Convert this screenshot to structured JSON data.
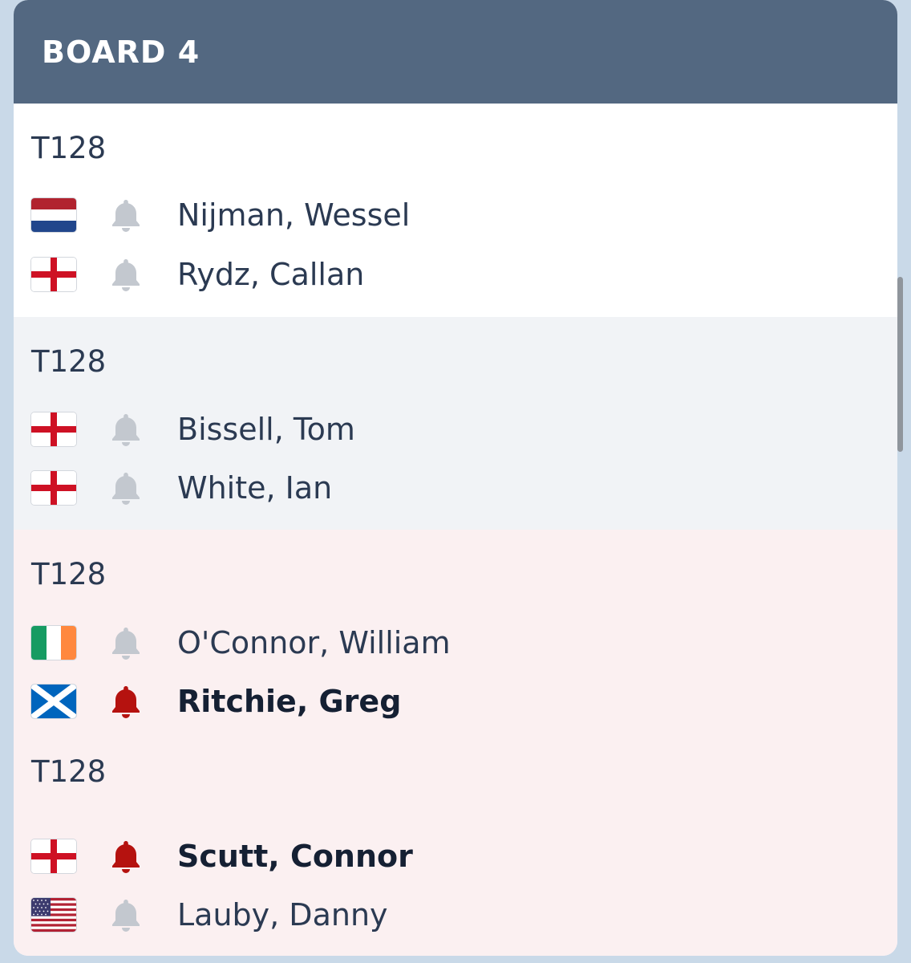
{
  "board": {
    "title": "BOARD 4"
  },
  "matches": [
    {
      "round": "T128",
      "players": [
        {
          "name": "Nijman, Wessel",
          "flag": "netherlands-flag",
          "bell": "bell-inactive",
          "highlight": false
        },
        {
          "name": "Rydz, Callan",
          "flag": "england-flag",
          "bell": "bell-inactive",
          "highlight": false
        }
      ]
    },
    {
      "round": "T128",
      "players": [
        {
          "name": "Bissell, Tom",
          "flag": "england-flag",
          "bell": "bell-inactive",
          "highlight": false
        },
        {
          "name": "White, Ian",
          "flag": "england-flag",
          "bell": "bell-inactive",
          "highlight": false
        }
      ]
    },
    {
      "round": "T128",
      "players": [
        {
          "name": "O'Connor, William",
          "flag": "ireland-flag",
          "bell": "bell-inactive",
          "highlight": false
        },
        {
          "name": "Ritchie, Greg",
          "flag": "scotland-flag",
          "bell": "bell-active",
          "highlight": true
        }
      ]
    },
    {
      "round": "T128",
      "players": [
        {
          "name": "Scutt, Connor",
          "flag": "england-flag",
          "bell": "bell-active",
          "highlight": true
        },
        {
          "name": "Lauby, Danny",
          "flag": "usa-flag",
          "bell": "bell-inactive",
          "highlight": false
        }
      ]
    }
  ],
  "colors": {
    "header_bg": "#536881",
    "bell_inactive": "#c3c8cf",
    "bell_active": "#b5120f",
    "text": "#2b3a52"
  }
}
